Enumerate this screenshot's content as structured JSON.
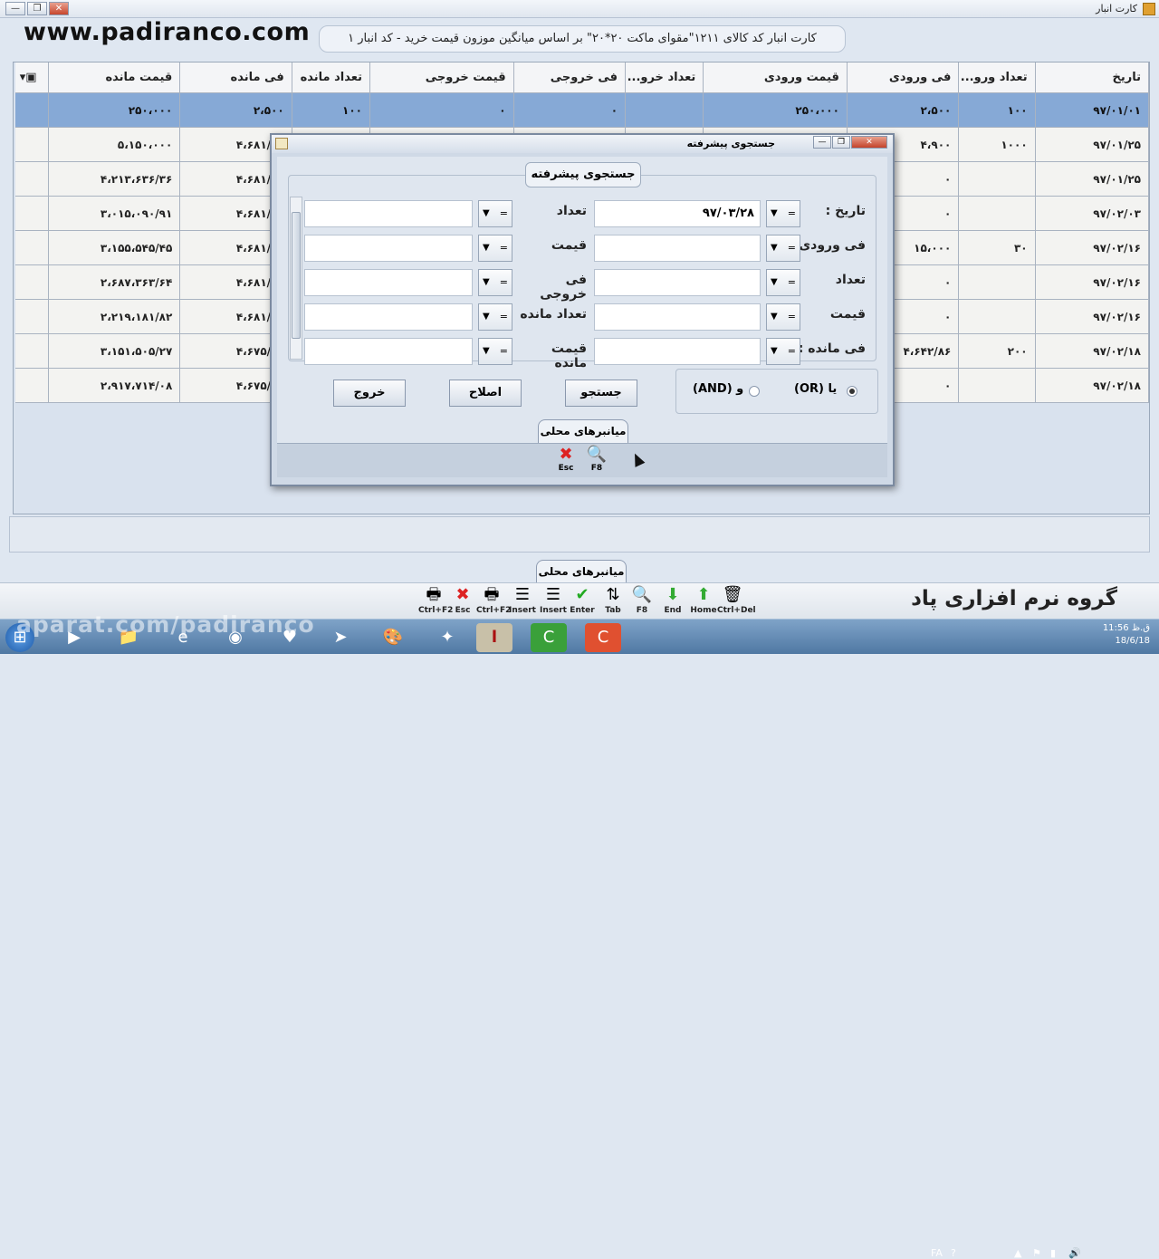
{
  "window": {
    "title": "کارت انبار",
    "buttons": [
      "—",
      "❐",
      "✕"
    ]
  },
  "watermark": "www.padiranco.com",
  "card_title": "کارت انبار کد کالای ۱۲۱۱\"مقوای ماکت ۲۰*۲۰\" بر اساس میانگین موزون قیمت خرید - کد انبار ۱",
  "grid": {
    "headers": [
      "تاریخ",
      "تعداد ورو...",
      "فی ورودی",
      "قیمت ورودی",
      "تعداد خرو...",
      "فی خروجی",
      "قیمت خروجی",
      "تعداد مانده",
      "فی مانده",
      "قیمت مانده"
    ],
    "rows": [
      [
        "۹۷/۰۱/۰۱",
        "۱۰۰",
        "۲،۵۰۰",
        "۲۵۰،۰۰۰",
        "",
        "۰",
        "۰",
        "۱۰۰",
        "۲،۵۰۰",
        "۲۵۰،۰۰۰"
      ],
      [
        "۹۷/۰۱/۲۵",
        "۱۰۰۰",
        "۴،۹۰۰",
        "",
        "",
        "",
        "",
        "",
        "۴،۶۸۱/۸۱",
        "۵،۱۵۰،۰۰۰"
      ],
      [
        "۹۷/۰۱/۲۵",
        "",
        "۰",
        "",
        "",
        "",
        "",
        "",
        "۴،۶۸۱/۸۱",
        "۴،۲۱۳،۶۳۶/۳۶"
      ],
      [
        "۹۷/۰۲/۰۳",
        "",
        "۰",
        "",
        "",
        "",
        "",
        "",
        "۴،۶۸۱/۸۱",
        "۳،۰۱۵،۰۹۰/۹۱"
      ],
      [
        "۹۷/۰۲/۱۶",
        "۳۰",
        "۱۵،۰۰۰",
        "",
        "",
        "",
        "",
        "",
        "۴،۶۸۱/۸۱",
        "۳،۱۵۵،۵۴۵/۴۵"
      ],
      [
        "۹۷/۰۲/۱۶",
        "",
        "۰",
        "",
        "",
        "",
        "",
        "",
        "۴،۶۸۱/۸۱",
        "۲،۶۸۷،۳۶۳/۶۴"
      ],
      [
        "۹۷/۰۲/۱۶",
        "",
        "۰",
        "",
        "",
        "",
        "",
        "",
        "۴،۶۸۱/۸۱",
        "۲،۲۱۹،۱۸۱/۸۲"
      ],
      [
        "۹۷/۰۲/۱۸",
        "۲۰۰",
        "۴،۶۴۲/۸۶",
        "",
        "",
        "",
        "",
        "",
        "۴،۶۷۵/۸۱",
        "۳،۱۵۱،۵۰۵/۲۷"
      ],
      [
        "۹۷/۰۲/۱۸",
        "",
        "۰",
        "",
        "",
        "",
        "",
        "",
        "۴،۶۷۵/۸۱",
        "۲،۹۱۷،۷۱۴/۰۸"
      ]
    ]
  },
  "local_tab": "میانبرهای محلی",
  "toolbar": [
    {
      "icon": "printer-icon",
      "glyph": "🖶",
      "label": "Ctrl+F2"
    },
    {
      "icon": "cancel-icon",
      "glyph": "✖",
      "label": "Esc",
      "color": "#d22"
    },
    {
      "icon": "printer-icon",
      "glyph": "🖶",
      "label": "Ctrl+F2"
    },
    {
      "icon": "insert-icon",
      "glyph": "☰",
      "label": "Insert"
    },
    {
      "icon": "insert-icon",
      "glyph": "☰",
      "label": "Insert"
    },
    {
      "icon": "check-icon",
      "glyph": "✔",
      "label": "Enter",
      "color": "#2a2"
    },
    {
      "icon": "sort-icon",
      "glyph": "⇅",
      "label": "Tab"
    },
    {
      "icon": "search-icon",
      "glyph": "🔍",
      "label": "F8"
    },
    {
      "icon": "end-icon",
      "glyph": "⬇",
      "label": "End",
      "color": "#3a3"
    },
    {
      "icon": "home-icon",
      "glyph": "⬆",
      "label": "Home",
      "color": "#3a3"
    },
    {
      "icon": "delete-icon",
      "glyph": "🗑",
      "label": "Ctrl+Del"
    }
  ],
  "brand": "گروه نرم افزاری پاد",
  "taskbar_watermark": "aparat.com/padiranco",
  "clock": {
    "time": "11:56 ق.ظ",
    "date": "18/6/18"
  },
  "tray": {
    "lang": "FA"
  },
  "dialog": {
    "title": "جستجوی پیشرفته",
    "legend": "جستجوی پیشرفته",
    "right_labels": [
      "تاریخ :",
      "فی ورودی",
      "تعداد",
      "قیمت",
      "فی مانده :"
    ],
    "right_values": [
      "۹۷/۰۳/۲۸",
      "",
      "",
      "",
      ""
    ],
    "left_labels": [
      "تعداد",
      "قیمت",
      "فی خروجی",
      "تعداد مانده",
      "قیمت مانده"
    ],
    "left_values": [
      "",
      "",
      "",
      "",
      ""
    ],
    "op_symbol": "=",
    "buttons": {
      "exit": "خروج",
      "edit": "اصلاح",
      "search": "جستجو"
    },
    "radio": {
      "or": "یا (OR)",
      "and": "و (AND)"
    },
    "local_tab": "میانبرهای محلی",
    "strip": [
      {
        "icon": "cancel-icon",
        "glyph": "✖",
        "label": "Esc"
      },
      {
        "icon": "search-icon",
        "glyph": "🔍",
        "label": "F8"
      }
    ]
  }
}
